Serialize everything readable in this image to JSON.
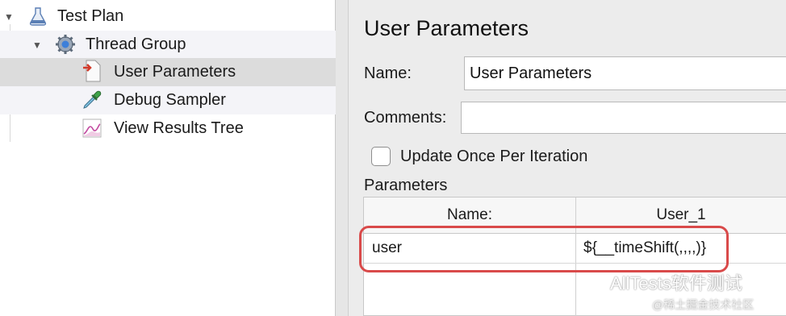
{
  "tree": {
    "items": [
      {
        "label": "Test Plan",
        "icon": "flask-icon",
        "expanded": true
      },
      {
        "label": "Thread Group",
        "icon": "gear-icon",
        "expanded": true
      },
      {
        "label": "User Parameters",
        "icon": "user-parameters-icon",
        "selected": true
      },
      {
        "label": "Debug Sampler",
        "icon": "dropper-icon"
      },
      {
        "label": "View Results Tree",
        "icon": "results-chart-icon"
      }
    ]
  },
  "panel": {
    "title": "User Parameters",
    "name_label": "Name:",
    "name_value": "User Parameters",
    "comments_label": "Comments:",
    "comments_value": "",
    "update_once_label": "Update Once Per Iteration",
    "update_once_checked": false,
    "parameters_label": "Parameters",
    "table": {
      "columns": [
        "Name:",
        "User_1"
      ],
      "rows": [
        [
          "user",
          "${__timeShift(,,,,)}"
        ]
      ]
    }
  },
  "highlight_color": "#d94a4a",
  "watermark": {
    "line1": "AllTests软件测试",
    "line2": "@稀土掘金技术社区"
  }
}
